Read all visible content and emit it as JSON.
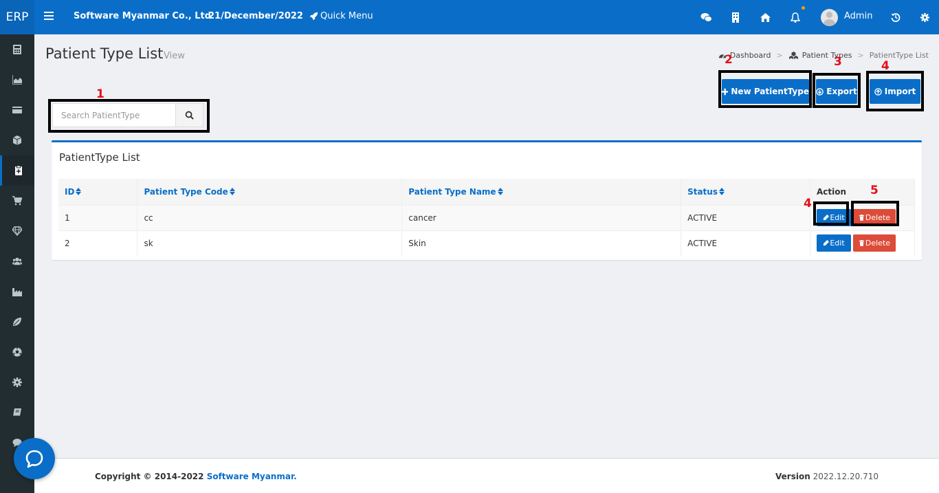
{
  "topbar": {
    "brand": "ERP",
    "company": "Software Myanmar Co., Ltd",
    "date": "21/December/2022",
    "quick_menu": "Quick Menu",
    "user": "Admin"
  },
  "page": {
    "title": "Patient Type List",
    "subtitle": "View"
  },
  "breadcrumb": [
    "Dashboard",
    "Patient Types",
    "PatientType List"
  ],
  "annotations": [
    "1",
    "2",
    "3",
    "4",
    "4",
    "5"
  ],
  "search": {
    "placeholder": "Search PatientType"
  },
  "actions": {
    "new_label": "New PatientType",
    "export_label": "Export",
    "import_label": "Import"
  },
  "card": {
    "title": "PatientType List"
  },
  "table": {
    "headers": [
      "ID",
      "Patient Type Code",
      "Patient Type Name",
      "Status",
      "Action"
    ],
    "rows": [
      {
        "id": "1",
        "code": "cc",
        "name": "cancer",
        "status": "ACTIVE"
      },
      {
        "id": "2",
        "code": "sk",
        "name": "Skin",
        "status": "ACTIVE"
      }
    ],
    "edit_label": "Edit",
    "delete_label": "Delete"
  },
  "footer": {
    "copyright_prefix": "Copyright © 2014-2022 ",
    "copyright_link": "Software Myanmar.",
    "version_label": "Version",
    "version_value": "2022.12.20.710"
  },
  "colors": {
    "primary": "#0a6ec8",
    "sidebar": "#222d32",
    "danger": "#dd4b39",
    "annotation": "#e3101a"
  },
  "icons": {
    "sidebar": [
      "calculator-icon",
      "area-chart-icon",
      "credit-card-icon",
      "cube-icon",
      "clipboard-icon",
      "cart-icon",
      "diamond-icon",
      "users-icon",
      "industry-icon",
      "leaf-icon",
      "soccer-ball-icon",
      "gear-icon",
      "book-icon",
      "comment-icon"
    ],
    "topbar": [
      "hamburger-icon",
      "rocket-icon",
      "wechat-icon",
      "building-icon",
      "home-icon",
      "bell-icon",
      "history-icon",
      "gear-icon"
    ]
  }
}
